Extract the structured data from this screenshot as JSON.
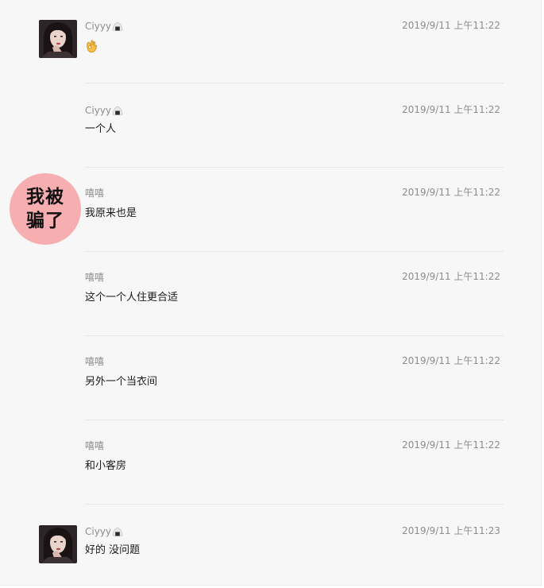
{
  "messages": [
    {
      "sender": "Ciyyy",
      "time": "2019/9/11 上午11:22",
      "text": "",
      "emoji": "ok-hand",
      "avatar": true
    },
    {
      "sender": "Ciyyy",
      "time": "2019/9/11 上午11:22",
      "text": "一个人",
      "avatar": false
    },
    {
      "sender": "嘻嘻",
      "time": "2019/9/11 上午11:22",
      "text": "我原来也是",
      "avatar": false
    },
    {
      "sender": "嘻嘻",
      "time": "2019/9/11 上午11:22",
      "text": "这个一个人住更合适",
      "avatar": false
    },
    {
      "sender": "嘻嘻",
      "time": "2019/9/11 上午11:22",
      "text": "另外一个当衣间",
      "avatar": false
    },
    {
      "sender": "嘻嘻",
      "time": "2019/9/11 上午11:22",
      "text": "和小客房",
      "avatar": false
    },
    {
      "sender": "Ciyyy",
      "time": "2019/9/11 上午11:23",
      "text": "好的 没问题",
      "avatar": true
    }
  ],
  "sticker": {
    "text": "我被骗了",
    "color": "#f6aeb0"
  },
  "colors": {
    "background": "#f7f7f7",
    "meta_text": "#8c8c8c",
    "body_text": "#1a1a1a",
    "divider": "#e6e6e6"
  }
}
